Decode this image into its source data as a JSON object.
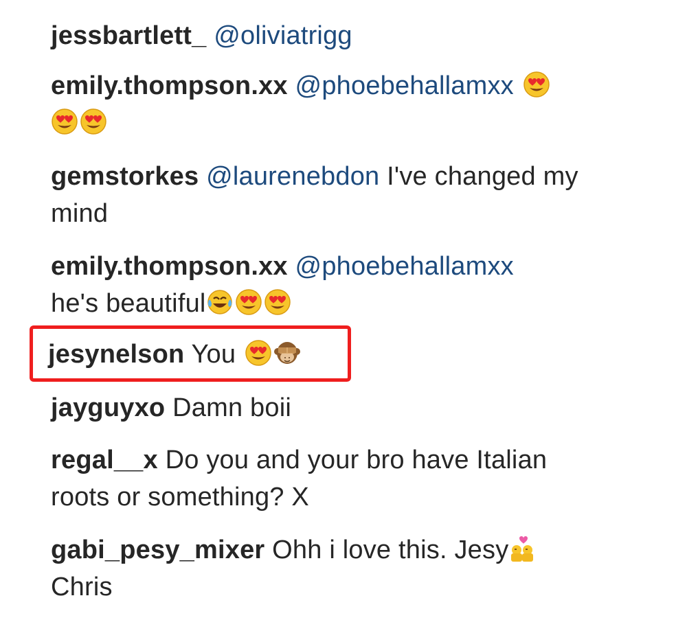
{
  "comments": [
    {
      "user": "jessbartlett_",
      "mention": "@oliviatrigg",
      "text": "",
      "emojis": []
    },
    {
      "user": "emily.thompson.xx",
      "mention": "@phoebehallamxx",
      "text": "",
      "emojis": [
        "heart-eyes-icon",
        "heart-eyes-icon",
        "heart-eyes-icon"
      ]
    },
    {
      "user": "gemstorkes",
      "mention": "@laurenebdon",
      "text": "I've changed my mind",
      "emojis": []
    },
    {
      "user": "emily.thompson.xx",
      "mention": "@phoebehallamxx",
      "text": "he's beautiful",
      "emojis": [
        "tears-of-joy-icon",
        "heart-eyes-icon",
        "heart-eyes-icon"
      ]
    },
    {
      "user": "jesynelson",
      "mention": "",
      "text": "You",
      "emojis": [
        "heart-eyes-icon",
        "see-no-evil-monkey-icon"
      ]
    },
    {
      "user": "jayguyxo",
      "mention": "",
      "text": "Damn boii",
      "emojis": []
    },
    {
      "user": "regal__x",
      "mention": "",
      "text": "Do you and your bro have Italian roots or something? X",
      "emojis": []
    },
    {
      "user": "gabi_pesy_mixer",
      "mention": "",
      "text": "Ohh i love this. Jesy",
      "emojis": [
        "couple-with-heart-icon"
      ],
      "text_after": "Chris"
    }
  ],
  "highlight": {
    "color": "#ef1e1e",
    "target": "jesynelson"
  },
  "colors": {
    "mention": "#1d4a7d",
    "text": "#262626",
    "highlight": "#ef1e1e"
  }
}
